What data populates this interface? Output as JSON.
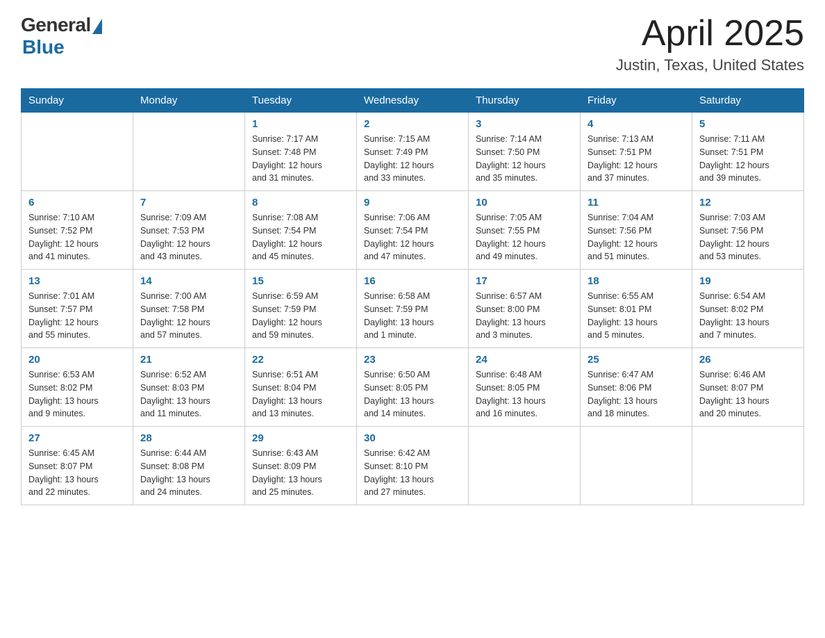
{
  "logo": {
    "general": "General",
    "blue": "Blue"
  },
  "header": {
    "month": "April 2025",
    "location": "Justin, Texas, United States"
  },
  "weekdays": [
    "Sunday",
    "Monday",
    "Tuesday",
    "Wednesday",
    "Thursday",
    "Friday",
    "Saturday"
  ],
  "weeks": [
    [
      {
        "day": "",
        "info": ""
      },
      {
        "day": "",
        "info": ""
      },
      {
        "day": "1",
        "info": "Sunrise: 7:17 AM\nSunset: 7:48 PM\nDaylight: 12 hours\nand 31 minutes."
      },
      {
        "day": "2",
        "info": "Sunrise: 7:15 AM\nSunset: 7:49 PM\nDaylight: 12 hours\nand 33 minutes."
      },
      {
        "day": "3",
        "info": "Sunrise: 7:14 AM\nSunset: 7:50 PM\nDaylight: 12 hours\nand 35 minutes."
      },
      {
        "day": "4",
        "info": "Sunrise: 7:13 AM\nSunset: 7:51 PM\nDaylight: 12 hours\nand 37 minutes."
      },
      {
        "day": "5",
        "info": "Sunrise: 7:11 AM\nSunset: 7:51 PM\nDaylight: 12 hours\nand 39 minutes."
      }
    ],
    [
      {
        "day": "6",
        "info": "Sunrise: 7:10 AM\nSunset: 7:52 PM\nDaylight: 12 hours\nand 41 minutes."
      },
      {
        "day": "7",
        "info": "Sunrise: 7:09 AM\nSunset: 7:53 PM\nDaylight: 12 hours\nand 43 minutes."
      },
      {
        "day": "8",
        "info": "Sunrise: 7:08 AM\nSunset: 7:54 PM\nDaylight: 12 hours\nand 45 minutes."
      },
      {
        "day": "9",
        "info": "Sunrise: 7:06 AM\nSunset: 7:54 PM\nDaylight: 12 hours\nand 47 minutes."
      },
      {
        "day": "10",
        "info": "Sunrise: 7:05 AM\nSunset: 7:55 PM\nDaylight: 12 hours\nand 49 minutes."
      },
      {
        "day": "11",
        "info": "Sunrise: 7:04 AM\nSunset: 7:56 PM\nDaylight: 12 hours\nand 51 minutes."
      },
      {
        "day": "12",
        "info": "Sunrise: 7:03 AM\nSunset: 7:56 PM\nDaylight: 12 hours\nand 53 minutes."
      }
    ],
    [
      {
        "day": "13",
        "info": "Sunrise: 7:01 AM\nSunset: 7:57 PM\nDaylight: 12 hours\nand 55 minutes."
      },
      {
        "day": "14",
        "info": "Sunrise: 7:00 AM\nSunset: 7:58 PM\nDaylight: 12 hours\nand 57 minutes."
      },
      {
        "day": "15",
        "info": "Sunrise: 6:59 AM\nSunset: 7:59 PM\nDaylight: 12 hours\nand 59 minutes."
      },
      {
        "day": "16",
        "info": "Sunrise: 6:58 AM\nSunset: 7:59 PM\nDaylight: 13 hours\nand 1 minute."
      },
      {
        "day": "17",
        "info": "Sunrise: 6:57 AM\nSunset: 8:00 PM\nDaylight: 13 hours\nand 3 minutes."
      },
      {
        "day": "18",
        "info": "Sunrise: 6:55 AM\nSunset: 8:01 PM\nDaylight: 13 hours\nand 5 minutes."
      },
      {
        "day": "19",
        "info": "Sunrise: 6:54 AM\nSunset: 8:02 PM\nDaylight: 13 hours\nand 7 minutes."
      }
    ],
    [
      {
        "day": "20",
        "info": "Sunrise: 6:53 AM\nSunset: 8:02 PM\nDaylight: 13 hours\nand 9 minutes."
      },
      {
        "day": "21",
        "info": "Sunrise: 6:52 AM\nSunset: 8:03 PM\nDaylight: 13 hours\nand 11 minutes."
      },
      {
        "day": "22",
        "info": "Sunrise: 6:51 AM\nSunset: 8:04 PM\nDaylight: 13 hours\nand 13 minutes."
      },
      {
        "day": "23",
        "info": "Sunrise: 6:50 AM\nSunset: 8:05 PM\nDaylight: 13 hours\nand 14 minutes."
      },
      {
        "day": "24",
        "info": "Sunrise: 6:48 AM\nSunset: 8:05 PM\nDaylight: 13 hours\nand 16 minutes."
      },
      {
        "day": "25",
        "info": "Sunrise: 6:47 AM\nSunset: 8:06 PM\nDaylight: 13 hours\nand 18 minutes."
      },
      {
        "day": "26",
        "info": "Sunrise: 6:46 AM\nSunset: 8:07 PM\nDaylight: 13 hours\nand 20 minutes."
      }
    ],
    [
      {
        "day": "27",
        "info": "Sunrise: 6:45 AM\nSunset: 8:07 PM\nDaylight: 13 hours\nand 22 minutes."
      },
      {
        "day": "28",
        "info": "Sunrise: 6:44 AM\nSunset: 8:08 PM\nDaylight: 13 hours\nand 24 minutes."
      },
      {
        "day": "29",
        "info": "Sunrise: 6:43 AM\nSunset: 8:09 PM\nDaylight: 13 hours\nand 25 minutes."
      },
      {
        "day": "30",
        "info": "Sunrise: 6:42 AM\nSunset: 8:10 PM\nDaylight: 13 hours\nand 27 minutes."
      },
      {
        "day": "",
        "info": ""
      },
      {
        "day": "",
        "info": ""
      },
      {
        "day": "",
        "info": ""
      }
    ]
  ]
}
